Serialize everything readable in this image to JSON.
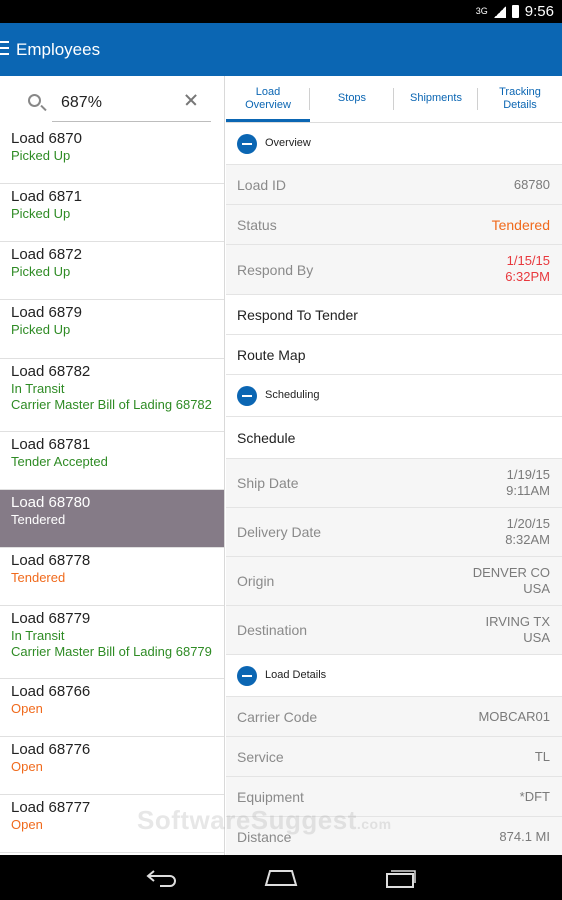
{
  "status_bar": {
    "signal": "3G",
    "time": "9:56"
  },
  "app_bar": {
    "title": "Employees",
    "menu_icon": "hamburger-menu-icon"
  },
  "search": {
    "value": "687%",
    "icon": "search-icon",
    "clear_icon": "clear-icon"
  },
  "loads": [
    {
      "title": "Load 6870",
      "status": "Picked Up",
      "status_color": "green",
      "extra": ""
    },
    {
      "title": "Load 6871",
      "status": "Picked Up",
      "status_color": "green",
      "extra": ""
    },
    {
      "title": "Load 6872",
      "status": "Picked Up",
      "status_color": "green",
      "extra": ""
    },
    {
      "title": "Load 6879",
      "status": "Picked Up",
      "status_color": "green",
      "extra": ""
    },
    {
      "title": "Load 68782",
      "status": "In Transit",
      "status_color": "green",
      "extra": "Carrier Master Bill of Lading 68782"
    },
    {
      "title": "Load 68781",
      "status": "Tender Accepted",
      "status_color": "green",
      "extra": ""
    },
    {
      "title": "Load 68780",
      "status": "Tendered",
      "status_color": "white",
      "extra": ""
    },
    {
      "title": "Load 68778",
      "status": "Tendered",
      "status_color": "orange",
      "extra": ""
    },
    {
      "title": "Load 68779",
      "status": "In Transit",
      "status_color": "green",
      "extra": "Carrier Master Bill of Lading 68779"
    },
    {
      "title": "Load 68766",
      "status": "Open",
      "status_color": "orange",
      "extra": ""
    },
    {
      "title": "Load 68776",
      "status": "Open",
      "status_color": "orange",
      "extra": ""
    },
    {
      "title": "Load 68777",
      "status": "Open",
      "status_color": "orange",
      "extra": ""
    }
  ],
  "tabs": [
    {
      "line1": "Load",
      "line2": "Overview",
      "active": true
    },
    {
      "line1": "Stops",
      "line2": "",
      "active": false
    },
    {
      "line1": "Shipments",
      "line2": "",
      "active": false
    },
    {
      "line1": "Tracking",
      "line2": "Details",
      "active": false
    }
  ],
  "overview": {
    "section_label": "Overview",
    "load_id_label": "Load ID",
    "load_id_value": "68780",
    "status_label": "Status",
    "status_value": "Tendered",
    "respond_by_label": "Respond By",
    "respond_by_date": "1/15/15",
    "respond_by_time": "6:32PM",
    "respond_to_tender": "Respond To Tender",
    "route_map": "Route Map"
  },
  "scheduling": {
    "section_label": "Scheduling",
    "schedule": "Schedule",
    "ship_date_label": "Ship Date",
    "ship_date": "1/19/15",
    "ship_time": "9:11AM",
    "delivery_date_label": "Delivery Date",
    "delivery_date": "1/20/15",
    "delivery_time": "8:32AM",
    "origin_label": "Origin",
    "origin_city": "DENVER CO",
    "origin_country": "USA",
    "destination_label": "Destination",
    "destination_city": "IRVING TX",
    "destination_country": "USA"
  },
  "load_details": {
    "section_label": "Load Details",
    "carrier_code_label": "Carrier Code",
    "carrier_code": "MOBCAR01",
    "service_label": "Service",
    "service": "TL",
    "equipment_label": "Equipment",
    "equipment": "*DFT",
    "distance_label": "Distance",
    "distance": "874.1 MI"
  },
  "watermark": {
    "text": "SoftwareSuggest",
    "suffix": ".com"
  },
  "colors": {
    "brand": "#0b66b3",
    "green": "#2e8b24",
    "orange": "#f06a1c",
    "red": "#e8383d",
    "selected": "#857b87"
  }
}
